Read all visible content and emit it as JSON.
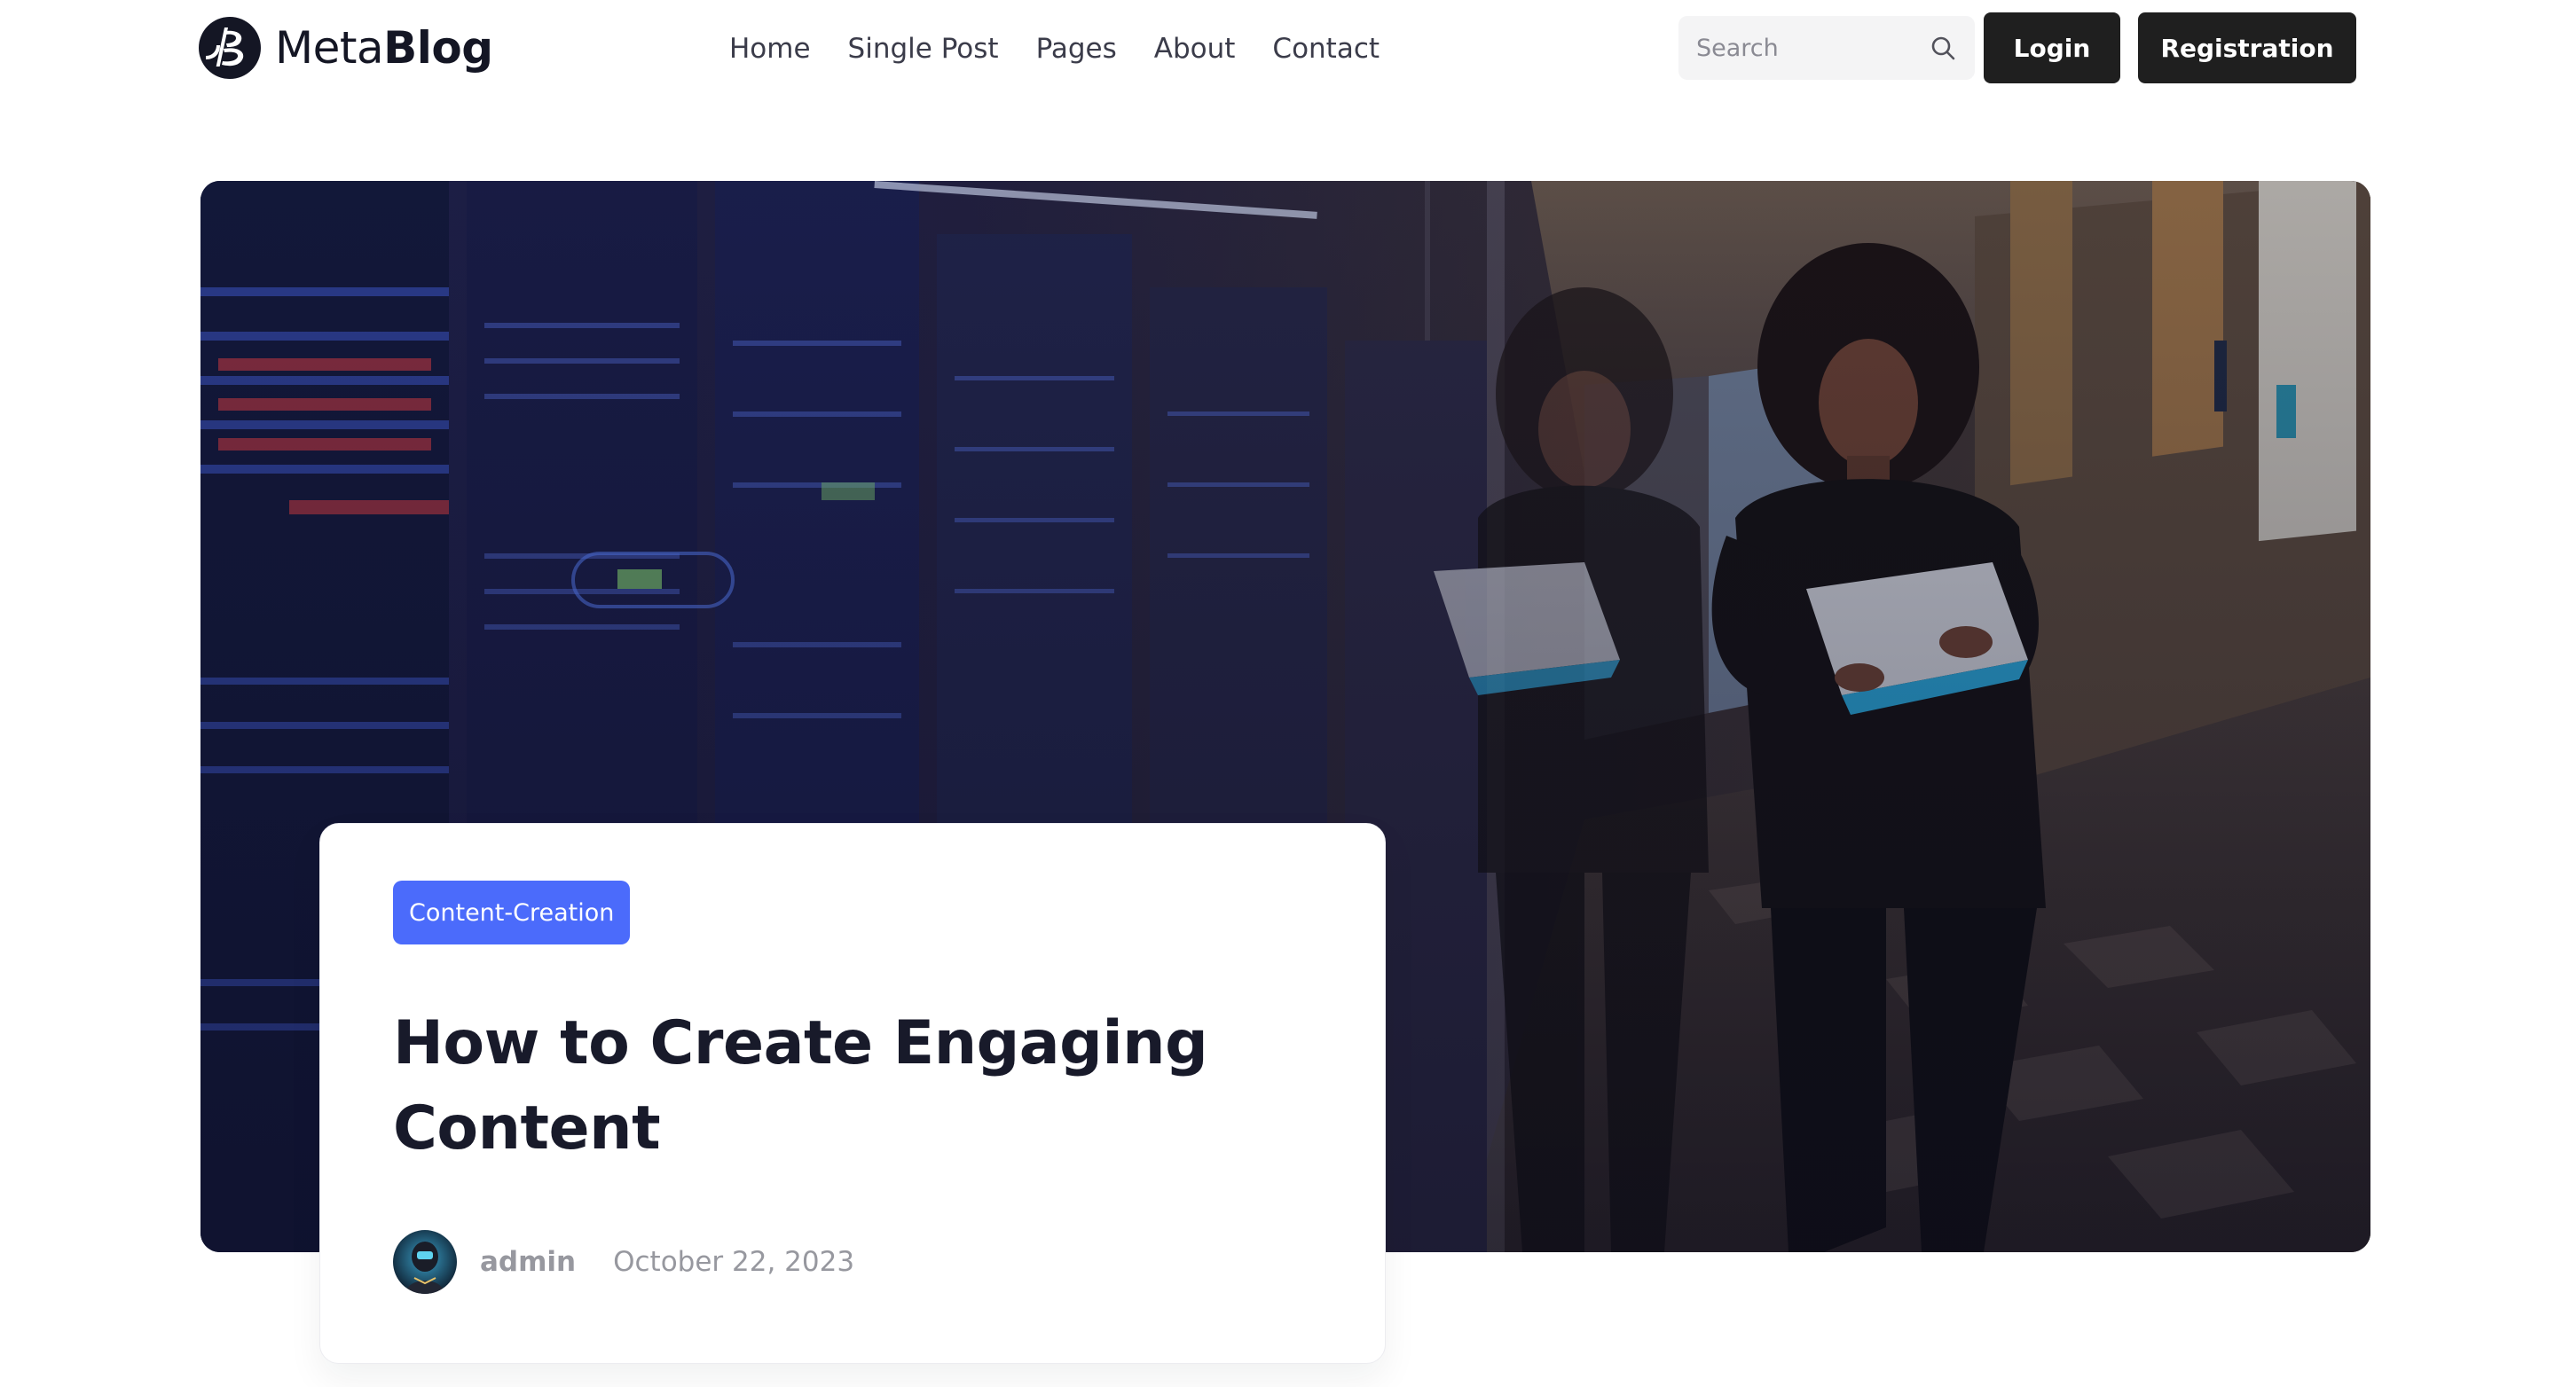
{
  "header": {
    "logo": {
      "light": "Meta",
      "bold": "Blog"
    },
    "nav": [
      {
        "label": "Home"
      },
      {
        "label": "Single Post"
      },
      {
        "label": "Pages"
      },
      {
        "label": "About"
      },
      {
        "label": "Contact"
      }
    ],
    "search": {
      "placeholder": "Search",
      "value": ""
    },
    "login_label": "Login",
    "register_label": "Registration"
  },
  "hero": {
    "image": "woman-holding-laptop-in-server-room-corridor"
  },
  "post": {
    "category": "Content-Creation",
    "title": "How to Create Engaging Content",
    "author": "admin",
    "date": "October 22, 2023"
  },
  "colors": {
    "accent": "#4b6bfb",
    "button_bg": "#1f1f1f",
    "text_dark": "#181a2a",
    "text_muted": "#97989f",
    "search_bg": "#f4f4f5"
  },
  "icons": {
    "logo": "metablog-logo-icon",
    "search": "search-icon",
    "avatar": "user-avatar"
  }
}
